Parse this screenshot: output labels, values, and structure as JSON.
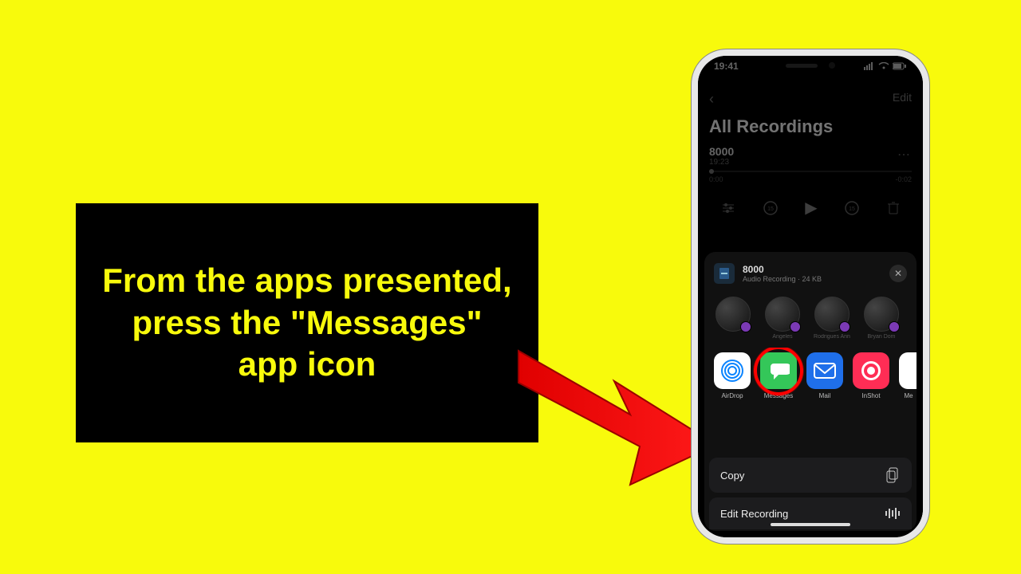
{
  "caption": "From the apps presented, press the \"Messages\" app icon",
  "phone": {
    "status_time": "19:41",
    "nav_edit": "Edit",
    "title": "All Recordings",
    "recording": {
      "name": "8000",
      "time": "19:23"
    },
    "progress": {
      "start": "0:00",
      "end": "-0:02"
    }
  },
  "share": {
    "file": {
      "name": "8000",
      "meta": "Audio Recording · 24 KB"
    },
    "contacts": [
      {
        "name": ""
      },
      {
        "name": "Angeles"
      },
      {
        "name": "Rodrigues Ann"
      },
      {
        "name": "Bryan Dom"
      }
    ],
    "apps": [
      {
        "label": "AirDrop"
      },
      {
        "label": "Messages"
      },
      {
        "label": "Mail"
      },
      {
        "label": "InShot"
      },
      {
        "label": "Me"
      }
    ],
    "actions": {
      "copy": "Copy",
      "edit_recording": "Edit Recording"
    }
  }
}
